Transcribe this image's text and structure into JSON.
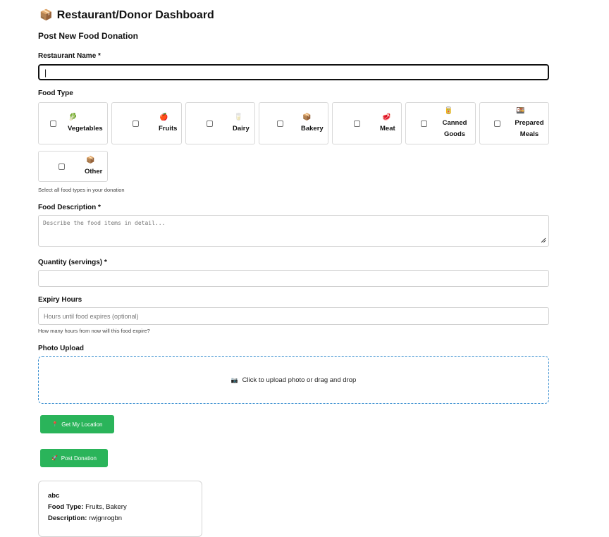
{
  "header": {
    "icon": "📦",
    "title": "Restaurant/Donor Dashboard"
  },
  "form": {
    "title": "Post New Food Donation",
    "restaurant_name": {
      "label": "Restaurant Name *",
      "value": "|"
    },
    "food_type": {
      "label": "Food Type",
      "options": [
        {
          "emoji": "🥬",
          "label": "Vegetables"
        },
        {
          "emoji": "🍎",
          "label": "Fruits"
        },
        {
          "emoji": "🥛",
          "label": "Dairy"
        },
        {
          "emoji": "📦",
          "label": "Bakery"
        },
        {
          "emoji": "🥩",
          "label": "Meat"
        },
        {
          "emoji": "🥫",
          "label": "Canned Goods"
        },
        {
          "emoji": "🍱",
          "label": "Prepared Meals"
        },
        {
          "emoji": "📦",
          "label": "Other"
        }
      ],
      "help": "Select all food types in your donation"
    },
    "description": {
      "label": "Food Description *",
      "placeholder": "Describe the food items in detail..."
    },
    "quantity": {
      "label": "Quantity (servings) *",
      "value": ""
    },
    "expiry": {
      "label": "Expiry Hours",
      "placeholder": "Hours until food expires (optional)",
      "help": "How many hours from now will this food expire?"
    },
    "photo": {
      "label": "Photo Upload",
      "icon": "📷",
      "text": "Click to upload photo or drag and drop"
    },
    "location_button": {
      "icon": "📍",
      "label": "Get My Location"
    },
    "post_button": {
      "icon": "🚀",
      "label": "Post Donation"
    }
  },
  "donation_card": {
    "title": "abc",
    "food_type_label": "Food Type:",
    "food_type_value": "Fruits, Bakery",
    "description_label": "Description:",
    "description_value": "rwjgnrogbn"
  }
}
